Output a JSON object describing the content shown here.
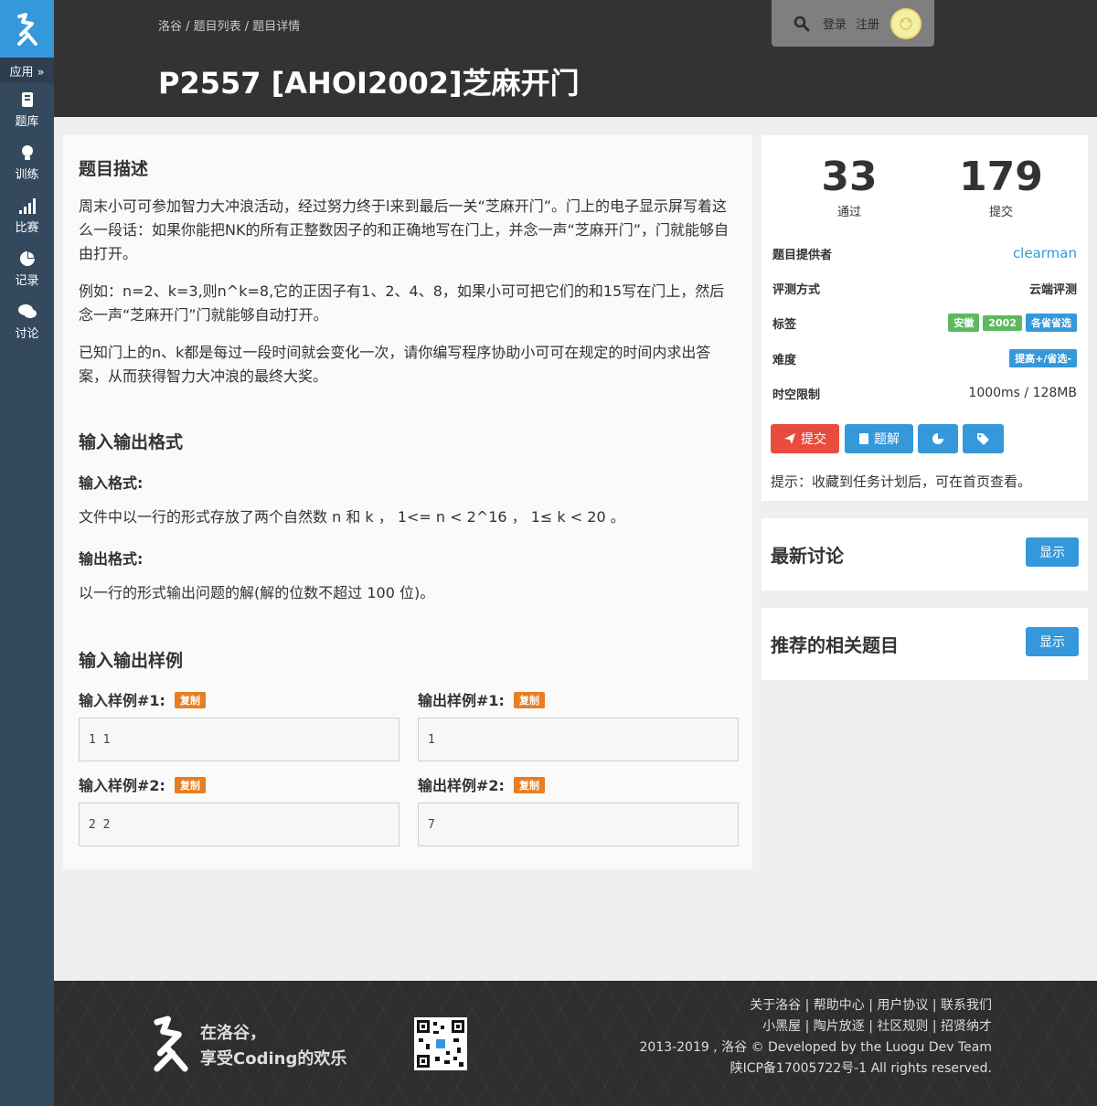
{
  "sidebar": {
    "apps_label": "应用 »",
    "items": [
      {
        "label": "题库",
        "icon": "book-icon"
      },
      {
        "label": "训练",
        "icon": "lightbulb-icon"
      },
      {
        "label": "比赛",
        "icon": "signal-icon"
      },
      {
        "label": "记录",
        "icon": "pie-chart-icon"
      },
      {
        "label": "讨论",
        "icon": "comments-icon"
      }
    ]
  },
  "header": {
    "breadcrumb": "洛谷 / 题目列表 / 题目详情",
    "title": "P2557 [AHOI2002]芝麻开门",
    "login": "登录",
    "register": "注册"
  },
  "problem": {
    "desc_title": "题目描述",
    "desc_p1": "周末小可可参加智力大冲浪活动，经过努力终于l来到最后一关“芝麻开门”。门上的电子显示屏写着这么一段话：如果你能把NK的所有正整数因子的和正确地写在门上，并念一声“芝麻开门”，门就能够自由打开。",
    "desc_p2": "例如：n=2、k=3,则n^k=8,它的正因子有1、2、4、8，如果小可可把它们的和15写在门上，然后念一声“芝麻开门”门就能够自动打开。",
    "desc_p3": "已知门上的n、k都是每过一段时间就会变化一次，请你编写程序协助小可可在规定的时间内求出答案，从而获得智力大冲浪的最终大奖。",
    "io_title": "输入输出格式",
    "input_format_label": "输入格式:",
    "input_format": "文件中以一行的形式存放了两个自然数 n 和 k ， 1<= n < 2^16 ， 1≤ k < 20 。",
    "output_format_label": "输出格式:",
    "output_format": "以一行的形式输出问题的解(解的位数不超过 100 位)。",
    "samples_title": "输入输出样例",
    "copy_label": "复制",
    "samples": [
      {
        "in_label": "输入样例#1:",
        "out_label": "输出样例#1:",
        "in": "1 1",
        "out": "1"
      },
      {
        "in_label": "输入样例#2:",
        "out_label": "输出样例#2:",
        "in": "2 2",
        "out": "7"
      }
    ]
  },
  "stats": {
    "passed": "33",
    "passed_label": "通过",
    "submitted": "179",
    "submitted_label": "提交"
  },
  "info": {
    "provider_label": "题目提供者",
    "provider": "clearman",
    "judge_label": "评测方式",
    "judge": "云端评测",
    "tags_label": "标签",
    "tags": [
      "安徽",
      "2002",
      "各省省选"
    ],
    "difficulty_label": "难度",
    "difficulty": "提高+/省选-",
    "limit_label": "时空限制",
    "limit": "1000ms / 128MB"
  },
  "actions": {
    "submit": "提交",
    "solution": "题解",
    "hint": "提示：收藏到任务计划后，可在首页查看。"
  },
  "discuss": {
    "title": "最新讨论",
    "show": "显示"
  },
  "related": {
    "title": "推荐的相关题目",
    "show": "显示"
  },
  "footer": {
    "slogan1": "在洛谷，",
    "slogan2": "享受Coding的欢乐",
    "links1": "关于洛谷 | 帮助中心 | 用户协议 | 联系我们",
    "links2": "小黑屋 | 陶片放逐 | 社区规则 | 招贤纳才",
    "copyright": "2013-2019 , 洛谷 © Developed by the Luogu Dev Team",
    "icp": "陕ICP备17005722号-1 All rights reserved."
  },
  "colors": {
    "sidebar": "#34495e",
    "brand_blue": "#3498db",
    "header": "#333333",
    "submit_red": "#e74c3c",
    "tag_green": "#5eb95e",
    "copy_orange": "#e67e22",
    "footer": "#2e2e2e"
  }
}
